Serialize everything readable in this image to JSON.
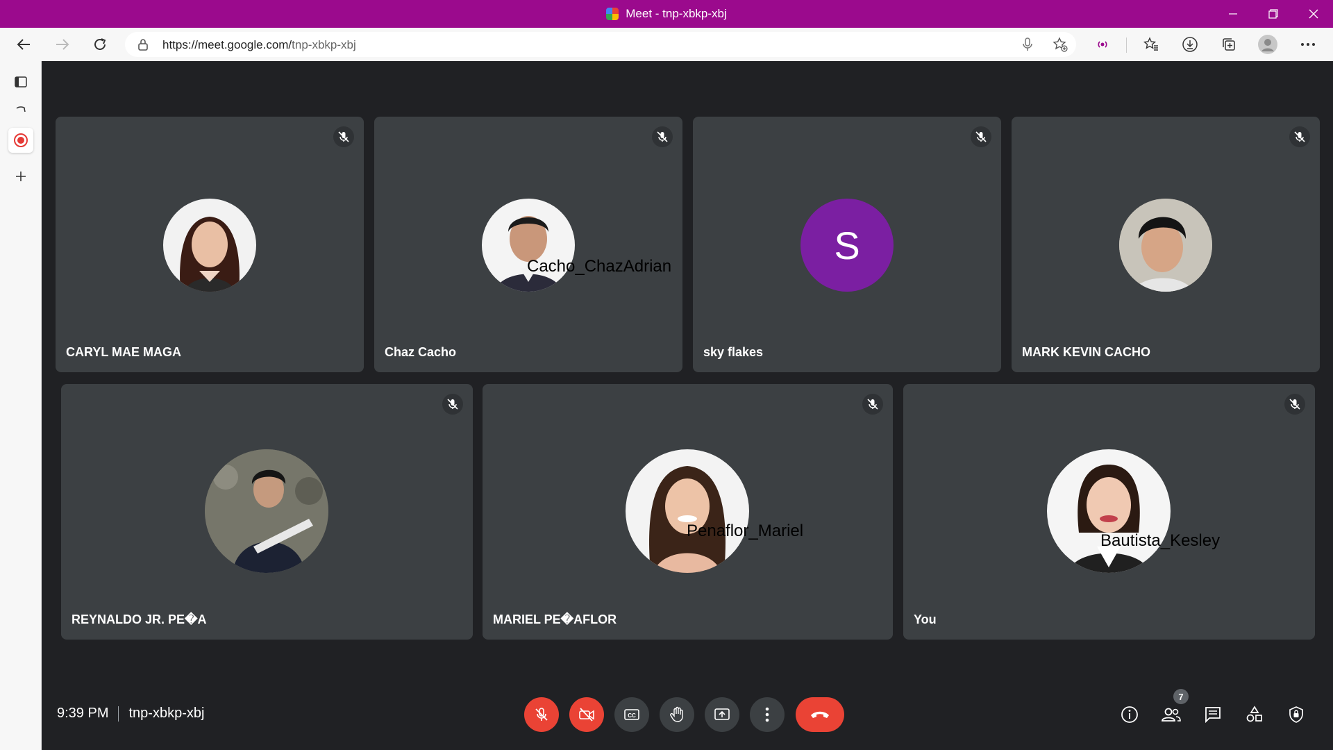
{
  "window": {
    "title": "Meet - tnp-xbkp-xbj"
  },
  "browser": {
    "url_host": "https://meet.google.com/",
    "url_path": "tnp-xbkp-xbj"
  },
  "meeting": {
    "time": "9:39 PM",
    "code": "tnp-xbkp-xbj",
    "participant_count": "7"
  },
  "participants": [
    {
      "name": "CARYL MAE MAGA",
      "avatar": "photo",
      "muted": true
    },
    {
      "name": "Chaz Cacho",
      "avatar": "photo",
      "overlay": "Cacho_ChazAdrian",
      "muted": true
    },
    {
      "name": "sky flakes",
      "avatar": "letter",
      "letter": "S",
      "avatar_color": "#7b1fa2",
      "muted": true
    },
    {
      "name": "MARK KEVIN CACHO",
      "avatar": "photo",
      "muted": true
    },
    {
      "name": "REYNALDO JR. PE�A",
      "avatar": "photo",
      "muted": true
    },
    {
      "name": "MARIEL PE�AFLOR",
      "avatar": "photo",
      "overlay": "Penaflor_Mariel",
      "muted": true
    },
    {
      "name": "You",
      "avatar": "photo",
      "overlay": "Bautista_Kesley",
      "muted": true
    }
  ],
  "colors": {
    "titlebar": "#9b0a8d",
    "meet_bg": "#202124",
    "tile_bg": "#3c4043",
    "danger": "#ea4335"
  }
}
